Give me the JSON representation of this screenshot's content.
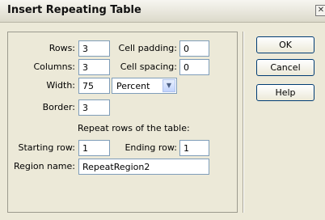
{
  "dialog": {
    "title": "Insert Repeating Table",
    "close_label": "✕"
  },
  "form": {
    "rows_label": "Rows:",
    "rows_value": "3",
    "cell_padding_label": "Cell padding:",
    "cell_padding_value": "0",
    "columns_label": "Columns:",
    "columns_value": "3",
    "cell_spacing_label": "Cell spacing:",
    "cell_spacing_value": "0",
    "width_label": "Width:",
    "width_value": "75",
    "width_unit": "Percent",
    "border_label": "Border:",
    "border_value": "3",
    "repeat_heading": "Repeat rows of the table:",
    "starting_row_label": "Starting row:",
    "starting_row_value": "1",
    "ending_row_label": "Ending row:",
    "ending_row_value": "1",
    "region_name_label": "Region name:",
    "region_name_value": "RepeatRegion2"
  },
  "buttons": {
    "ok": "OK",
    "cancel": "Cancel",
    "help": "Help"
  }
}
